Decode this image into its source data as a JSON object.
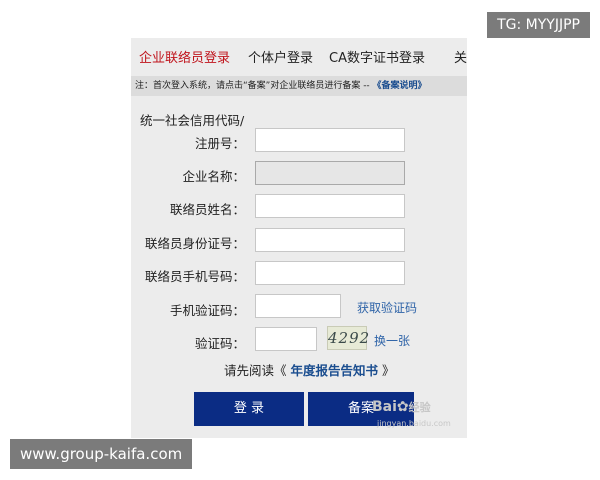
{
  "tabs": [
    {
      "label": "企业联络员登录"
    },
    {
      "label": "个体户登录"
    },
    {
      "label": "CA数字证书登录"
    },
    {
      "label": "关"
    }
  ],
  "notice": {
    "text": "注：首次登入系统，请点击“备案”对企业联络员进行备案 -- ",
    "link": "《备案说明》"
  },
  "form": {
    "credit_code_label": "统一社会信用代码/",
    "reg_no_label": "注册号：",
    "company_name_label": "企业名称：",
    "liaison_name_label": "联络员姓名：",
    "liaison_id_label": "联络员身份证号：",
    "liaison_phone_label": "联络员手机号码：",
    "sms_code_label": "手机验证码：",
    "get_code_link": "获取验证码",
    "captcha_label": "验证码：",
    "captcha_value": "4292",
    "refresh_captcha": "换一张"
  },
  "read_notice": {
    "prefix": "请先阅读《 ",
    "book": "年度报告告知书",
    "suffix": " 》"
  },
  "buttons": {
    "login": "登 录",
    "register": "备案"
  },
  "watermark": {
    "brand_a": "Bai",
    "brand_b": "经验",
    "url": "jingyan.baidu.com"
  },
  "overlays": {
    "top_right": "TG: MYYJJPP",
    "bottom_left": "www.group-kaifa.com"
  }
}
